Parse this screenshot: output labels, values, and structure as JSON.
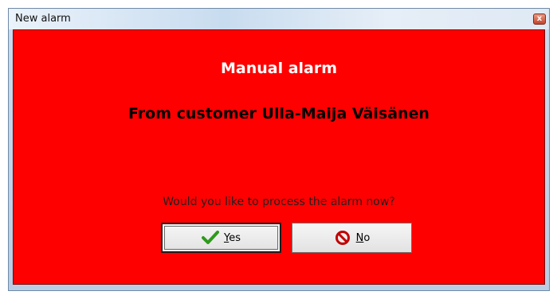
{
  "window": {
    "title": "New alarm",
    "close_glyph": "x"
  },
  "alarm": {
    "heading": "Manual alarm",
    "customer_line": "From customer Ulla-Maija Väisänen",
    "question": "Would you like to process the alarm now?",
    "background_color": "#ff0000"
  },
  "buttons": {
    "yes": {
      "mnemonic": "Y",
      "rest": "es",
      "icon": "checkmark-icon"
    },
    "no": {
      "mnemonic": "N",
      "rest": "o",
      "icon": "no-entry-icon"
    }
  }
}
